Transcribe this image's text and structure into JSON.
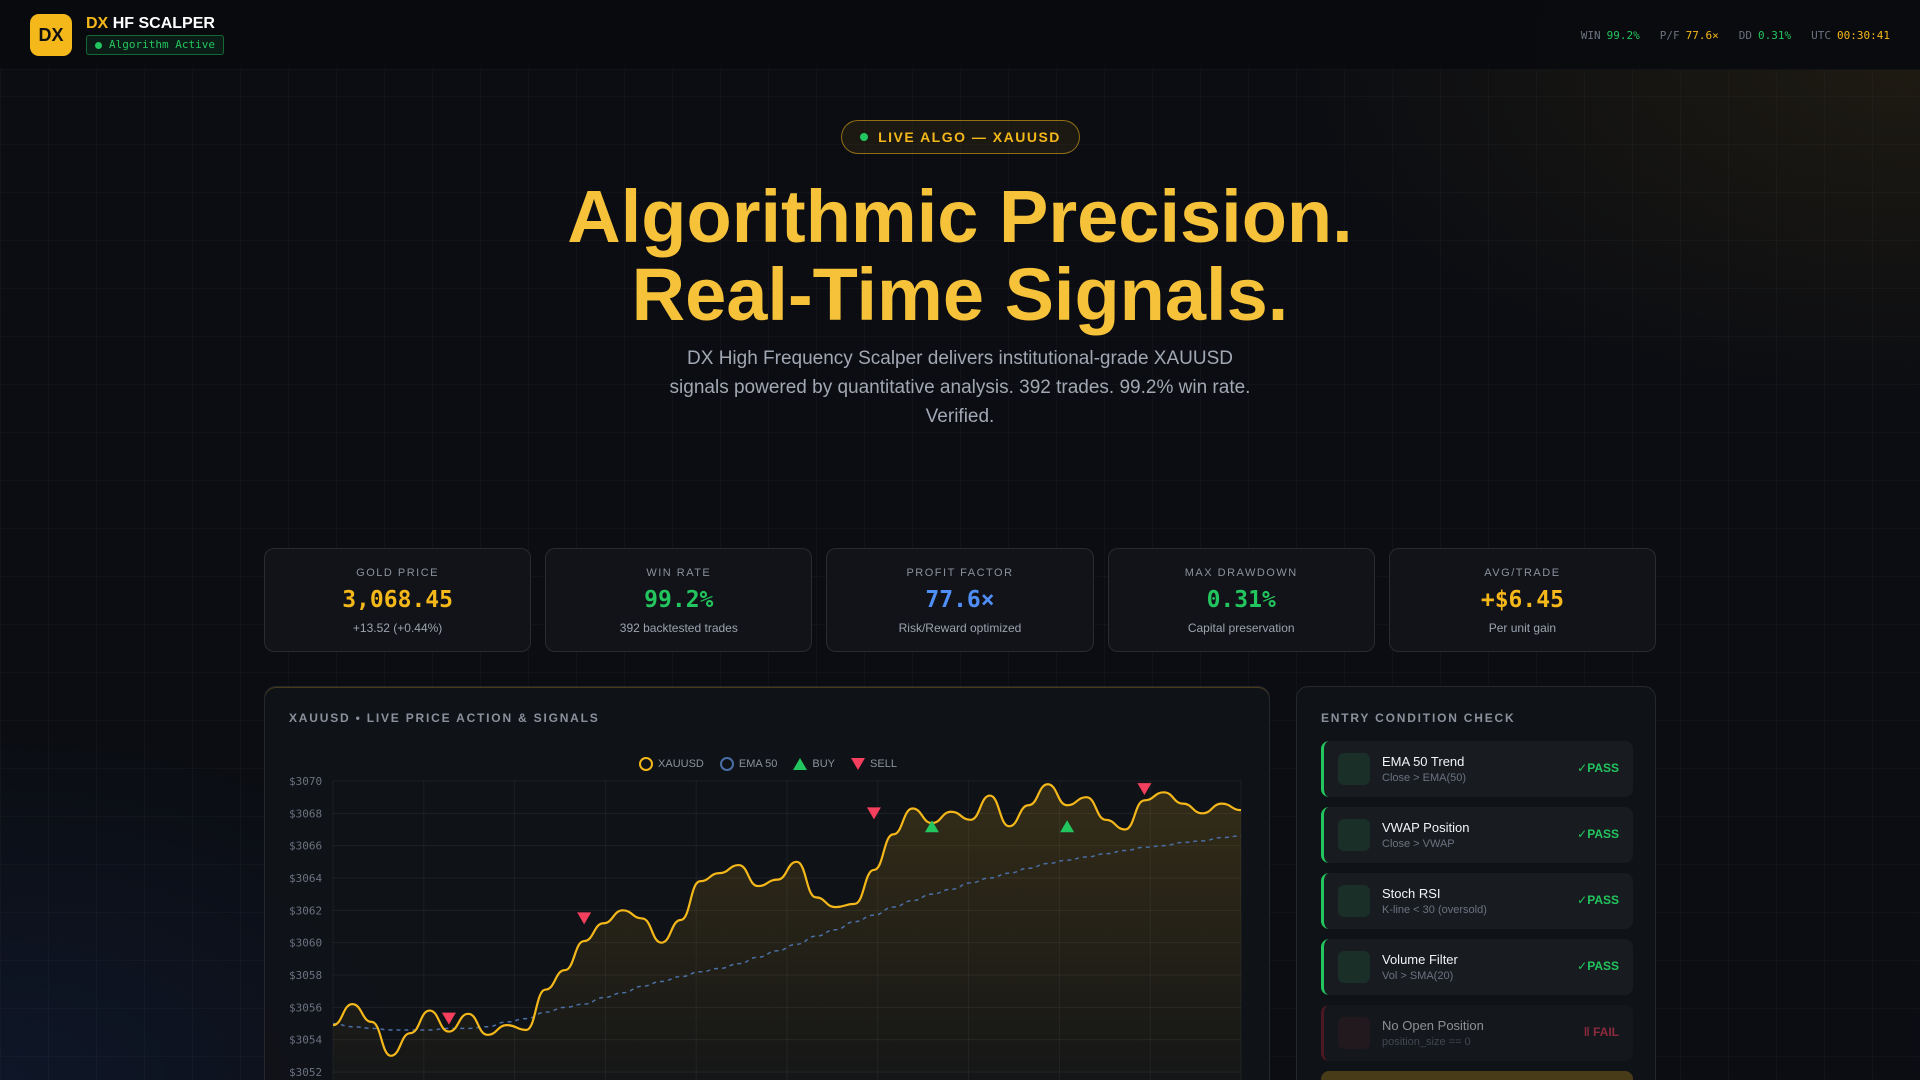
{
  "header": {
    "logo": "DX",
    "brand_prefix": "DX",
    "brand_name": "HF SCALPER",
    "status": "Algorithm Active",
    "stats": [
      {
        "label": "WIN",
        "value": "99.2%",
        "color": "#22c55e"
      },
      {
        "label": "P/F",
        "value": "77.6×",
        "color": "#f5b81a"
      },
      {
        "label": "DD",
        "value": "0.31%",
        "color": "#22c55e"
      },
      {
        "label": "UTC",
        "value": "00:30:41",
        "color": "#f5b81a"
      }
    ]
  },
  "hero": {
    "pill": "LIVE ALGO — XAUUSD",
    "title_line1": "Algorithmic Precision.",
    "title_line2": "Real-Time Signals.",
    "subtitle": "DX High Frequency Scalper delivers institutional-grade XAUUSD signals powered by quantitative analysis. 392 trades. 99.2% win rate. Verified."
  },
  "cards": [
    {
      "label": "GOLD PRICE",
      "value": "3,068.45",
      "sub": "+13.52 (+0.44%)",
      "color": "#f5b81a",
      "sub_color": "#22c55e"
    },
    {
      "label": "WIN RATE",
      "value": "99.2%",
      "sub": "392 backtested trades",
      "color": "#22c55e",
      "sub_color": "#9ca3af"
    },
    {
      "label": "PROFIT FACTOR",
      "value": "77.6×",
      "sub": "Risk/Reward optimized",
      "color": "#4f8ff7",
      "sub_color": "#9ca3af"
    },
    {
      "label": "MAX DRAWDOWN",
      "value": "0.31%",
      "sub": "Capital preservation",
      "color": "#22c55e",
      "sub_color": "#9ca3af"
    },
    {
      "label": "AVG/TRADE",
      "value": "+$6.45",
      "sub": "Per unit gain",
      "color": "#f5b81a",
      "sub_color": "#9ca3af"
    }
  ],
  "chart": {
    "title": "XAUUSD • LIVE PRICE ACTION & SIGNALS",
    "legend": [
      "XAUUSD",
      "EMA 50",
      "BUY",
      "SELL"
    ]
  },
  "chart_data": {
    "type": "line",
    "ylim": [
      3052,
      3070
    ],
    "yticks": [
      "$3070",
      "$3068",
      "$3066",
      "$3064",
      "$3062",
      "$3060",
      "$3058",
      "$3056",
      "$3054",
      "$3052"
    ],
    "grid": true,
    "colors": {
      "price": "#f5b81a",
      "ema": "#4a6fa5",
      "buy": "#22c55e",
      "sell": "#f43f5e"
    },
    "series": [
      {
        "name": "XAUUSD",
        "values": [
          3054.9,
          3056.2,
          3055.1,
          3053.0,
          3054.4,
          3055.8,
          3054.5,
          3055.6,
          3054.3,
          3054.9,
          3054.6,
          3057.1,
          3058.3,
          3060.1,
          3061.2,
          3062.0,
          3061.5,
          3060.0,
          3061.4,
          3063.8,
          3064.3,
          3064.8,
          3063.5,
          3063.9,
          3065.0,
          3062.8,
          3062.2,
          3062.4,
          3064.5,
          3066.7,
          3068.3,
          3067.4,
          3068.1,
          3067.6,
          3069.1,
          3067.2,
          3068.5,
          3069.8,
          3068.5,
          3069.0,
          3067.6,
          3067.0,
          3068.8,
          3069.3,
          3068.6,
          3068.0,
          3068.6,
          3068.2
        ]
      },
      {
        "name": "EMA 50",
        "values": [
          3055.0,
          3054.8,
          3054.7,
          3054.6,
          3054.6,
          3054.6,
          3054.7,
          3054.7,
          3054.8,
          3055.1,
          3055.3,
          3055.7,
          3056.0,
          3056.2,
          3056.6,
          3056.9,
          3057.3,
          3057.6,
          3057.9,
          3058.2,
          3058.4,
          3058.7,
          3059.1,
          3059.5,
          3059.9,
          3060.4,
          3060.8,
          3061.3,
          3061.7,
          3062.2,
          3062.6,
          3063.0,
          3063.3,
          3063.7,
          3064.0,
          3064.3,
          3064.6,
          3064.9,
          3065.1,
          3065.3,
          3065.5,
          3065.7,
          3065.9,
          3066.0,
          3066.2,
          3066.3,
          3066.5,
          3066.6
        ]
      }
    ],
    "buy_signals": [
      [
        31,
        3067.2
      ],
      [
        38,
        3067.2
      ]
    ],
    "sell_signals": [
      [
        6,
        3055.3
      ],
      [
        13,
        3061.5
      ],
      [
        28,
        3068.0
      ],
      [
        42,
        3069.5
      ]
    ]
  },
  "conditions": {
    "title": "ENTRY CONDITION CHECK",
    "items": [
      {
        "name": "EMA 50 Trend",
        "desc": "Close > EMA(50)",
        "status": "✓PASS",
        "pass": true
      },
      {
        "name": "VWAP Position",
        "desc": "Close > VWAP",
        "status": "✓PASS",
        "pass": true
      },
      {
        "name": "Stoch RSI",
        "desc": "K-line < 30 (oversold)",
        "status": "✓PASS",
        "pass": true
      },
      {
        "name": "Volume Filter",
        "desc": "Vol > SMA(20)",
        "status": "✓PASS",
        "pass": true
      },
      {
        "name": "No Open Position",
        "desc": "position_size == 0",
        "status": "‖ FAIL",
        "pass": false
      }
    ]
  }
}
